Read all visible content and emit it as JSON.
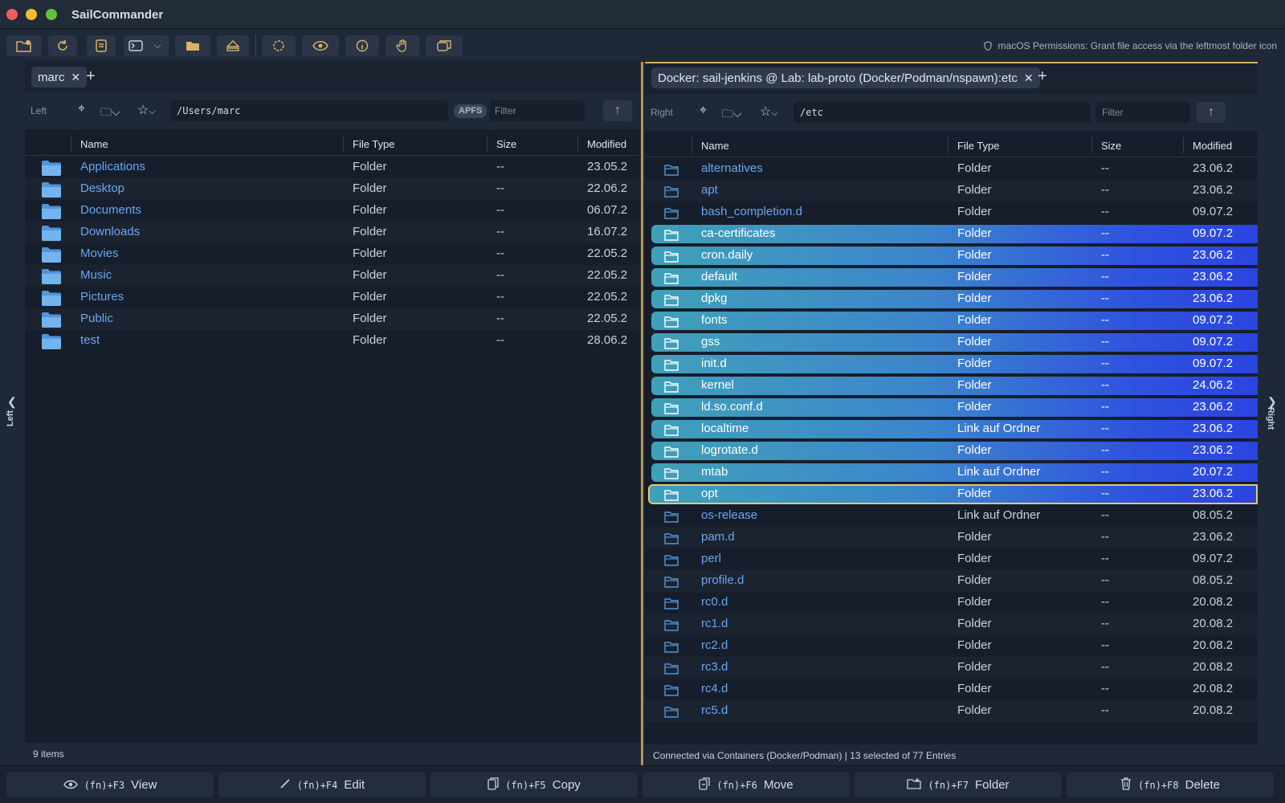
{
  "app": {
    "title": "SailCommander"
  },
  "toolbar": {
    "permissions_text": "macOS Permissions: Grant file access via the leftmost folder icon",
    "buttons": [
      "folder-plus-icon",
      "refresh-icon",
      "archive-icon",
      "terminal-icon",
      "chevron-down-icon",
      "folder-icon",
      "eject-icon",
      "circle-icon",
      "eye-icon",
      "info-icon",
      "hand-icon",
      "windows-icon"
    ]
  },
  "rails": {
    "left_label": "Left",
    "right_label": "Right"
  },
  "left": {
    "tab_label": "marc",
    "side_label": "Left",
    "path": "/Users/marc",
    "fs_badge": "APFS",
    "filter_placeholder": "Filter",
    "columns": {
      "name": "Name",
      "type": "File Type",
      "size": "Size",
      "modified": "Modified"
    },
    "status": "9 items",
    "rows": [
      {
        "name": "Applications",
        "type": "Folder",
        "size": "--",
        "modified": "23.05.2"
      },
      {
        "name": "Desktop",
        "type": "Folder",
        "size": "--",
        "modified": "22.06.2"
      },
      {
        "name": "Documents",
        "type": "Folder",
        "size": "--",
        "modified": "06.07.2"
      },
      {
        "name": "Downloads",
        "type": "Folder",
        "size": "--",
        "modified": "16.07.2"
      },
      {
        "name": "Movies",
        "type": "Folder",
        "size": "--",
        "modified": "22.05.2"
      },
      {
        "name": "Music",
        "type": "Folder",
        "size": "--",
        "modified": "22.05.2"
      },
      {
        "name": "Pictures",
        "type": "Folder",
        "size": "--",
        "modified": "22.05.2"
      },
      {
        "name": "Public",
        "type": "Folder",
        "size": "--",
        "modified": "22.05.2"
      },
      {
        "name": "test",
        "type": "Folder",
        "size": "--",
        "modified": "28.06.2"
      }
    ]
  },
  "right": {
    "tab_label": "Docker: sail-jenkins @ Lab: lab-proto (Docker/Podman/nspawn):etc",
    "side_label": "Right",
    "path": "/etc",
    "filter_placeholder": "Filter",
    "columns": {
      "name": "Name",
      "type": "File Type",
      "size": "Size",
      "modified": "Modified"
    },
    "status": "Connected via Containers (Docker/Podman) | 13 selected of 77 Entries",
    "rows": [
      {
        "name": "alternatives",
        "type": "Folder",
        "size": "--",
        "modified": "23.06.2",
        "selected": false
      },
      {
        "name": "apt",
        "type": "Folder",
        "size": "--",
        "modified": "23.06.2",
        "selected": false
      },
      {
        "name": "bash_completion.d",
        "type": "Folder",
        "size": "--",
        "modified": "09.07.2",
        "selected": false
      },
      {
        "name": "ca-certificates",
        "type": "Folder",
        "size": "--",
        "modified": "09.07.2",
        "selected": true
      },
      {
        "name": "cron.daily",
        "type": "Folder",
        "size": "--",
        "modified": "23.06.2",
        "selected": true
      },
      {
        "name": "default",
        "type": "Folder",
        "size": "--",
        "modified": "23.06.2",
        "selected": true
      },
      {
        "name": "dpkg",
        "type": "Folder",
        "size": "--",
        "modified": "23.06.2",
        "selected": true
      },
      {
        "name": "fonts",
        "type": "Folder",
        "size": "--",
        "modified": "09.07.2",
        "selected": true
      },
      {
        "name": "gss",
        "type": "Folder",
        "size": "--",
        "modified": "09.07.2",
        "selected": true
      },
      {
        "name": "init.d",
        "type": "Folder",
        "size": "--",
        "modified": "09.07.2",
        "selected": true
      },
      {
        "name": "kernel",
        "type": "Folder",
        "size": "--",
        "modified": "24.06.2",
        "selected": true
      },
      {
        "name": "ld.so.conf.d",
        "type": "Folder",
        "size": "--",
        "modified": "23.06.2",
        "selected": true
      },
      {
        "name": "localtime",
        "type": "Link auf Ordner",
        "size": "--",
        "modified": "23.06.2",
        "selected": true
      },
      {
        "name": "logrotate.d",
        "type": "Folder",
        "size": "--",
        "modified": "23.06.2",
        "selected": true
      },
      {
        "name": "mtab",
        "type": "Link auf Ordner",
        "size": "--",
        "modified": "20.07.2",
        "selected": true
      },
      {
        "name": "opt",
        "type": "Folder",
        "size": "--",
        "modified": "23.06.2",
        "selected": true,
        "focused": true
      },
      {
        "name": "os-release",
        "type": "Link auf Ordner",
        "size": "--",
        "modified": "08.05.2",
        "selected": false
      },
      {
        "name": "pam.d",
        "type": "Folder",
        "size": "--",
        "modified": "23.06.2",
        "selected": false
      },
      {
        "name": "perl",
        "type": "Folder",
        "size": "--",
        "modified": "09.07.2",
        "selected": false
      },
      {
        "name": "profile.d",
        "type": "Folder",
        "size": "--",
        "modified": "08.05.2",
        "selected": false
      },
      {
        "name": "rc0.d",
        "type": "Folder",
        "size": "--",
        "modified": "20.08.2",
        "selected": false
      },
      {
        "name": "rc1.d",
        "type": "Folder",
        "size": "--",
        "modified": "20.08.2",
        "selected": false
      },
      {
        "name": "rc2.d",
        "type": "Folder",
        "size": "--",
        "modified": "20.08.2",
        "selected": false
      },
      {
        "name": "rc3.d",
        "type": "Folder",
        "size": "--",
        "modified": "20.08.2",
        "selected": false
      },
      {
        "name": "rc4.d",
        "type": "Folder",
        "size": "--",
        "modified": "20.08.2",
        "selected": false
      },
      {
        "name": "rc5.d",
        "type": "Folder",
        "size": "--",
        "modified": "20.08.2",
        "selected": false
      }
    ]
  },
  "fkeys": [
    {
      "fn": "(fn)+F3",
      "label": "View",
      "icon": "eye-icon"
    },
    {
      "fn": "(fn)+F4",
      "label": "Edit",
      "icon": "pencil-icon"
    },
    {
      "fn": "(fn)+F5",
      "label": "Copy",
      "icon": "copy-icon"
    },
    {
      "fn": "(fn)+F6",
      "label": "Move",
      "icon": "move-icon"
    },
    {
      "fn": "(fn)+F7",
      "label": "Folder",
      "icon": "new-folder-icon"
    },
    {
      "fn": "(fn)+F8",
      "label": "Delete",
      "icon": "trash-icon"
    }
  ],
  "colors": {
    "accent": "#d9b35e",
    "link": "#6aa6f0",
    "sel_start": "#3fa0b9",
    "sel_end": "#2b44e0"
  }
}
